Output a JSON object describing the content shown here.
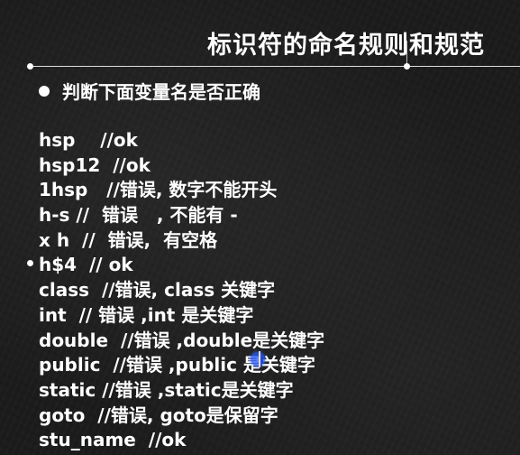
{
  "slide": {
    "title": "标识符的命名规则和规范",
    "bullet": "判断下面变量名是否正确",
    "lines": [
      "hsp    //ok",
      "hsp12  //ok",
      "1hsp   //错误, 数字不能开头",
      "h-s //  错误   , 不能有 -",
      "x h  //  错误,  有空格",
      "h$4  // ok",
      "class  //错误, class 关键字",
      "int  // 错误 ,int 是关键字",
      "double  //错误 ,double是关键字",
      "public  //错误 ,public 是关键字",
      "static //错误 ,static是关键字",
      "goto  //错误, goto是保留字",
      "stu_name  //ok"
    ]
  },
  "colors": {
    "background": "#1c1c1c",
    "text": "#ffffff",
    "cursor": "#2a5aff"
  },
  "icons": {
    "bullet": "filled-circle-bullet",
    "cursor": "mouse-cursor-highlight"
  }
}
